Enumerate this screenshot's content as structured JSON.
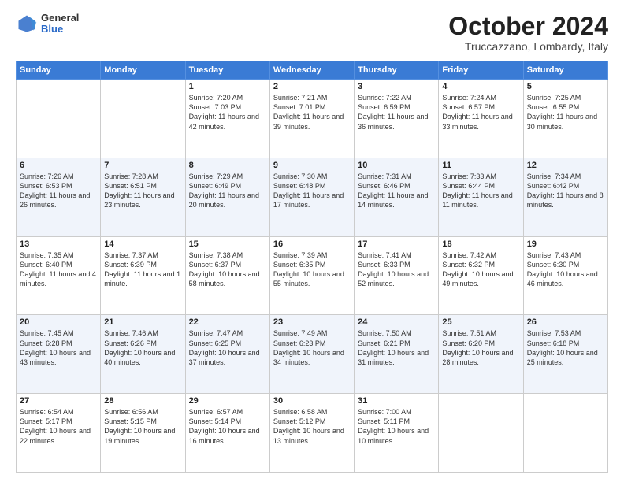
{
  "header": {
    "logo_general": "General",
    "logo_blue": "Blue",
    "title": "October 2024",
    "location": "Truccazzano, Lombardy, Italy"
  },
  "weekdays": [
    "Sunday",
    "Monday",
    "Tuesday",
    "Wednesday",
    "Thursday",
    "Friday",
    "Saturday"
  ],
  "weeks": [
    [
      {
        "day": "",
        "info": ""
      },
      {
        "day": "",
        "info": ""
      },
      {
        "day": "1",
        "info": "Sunrise: 7:20 AM\nSunset: 7:03 PM\nDaylight: 11 hours and 42 minutes."
      },
      {
        "day": "2",
        "info": "Sunrise: 7:21 AM\nSunset: 7:01 PM\nDaylight: 11 hours and 39 minutes."
      },
      {
        "day": "3",
        "info": "Sunrise: 7:22 AM\nSunset: 6:59 PM\nDaylight: 11 hours and 36 minutes."
      },
      {
        "day": "4",
        "info": "Sunrise: 7:24 AM\nSunset: 6:57 PM\nDaylight: 11 hours and 33 minutes."
      },
      {
        "day": "5",
        "info": "Sunrise: 7:25 AM\nSunset: 6:55 PM\nDaylight: 11 hours and 30 minutes."
      }
    ],
    [
      {
        "day": "6",
        "info": "Sunrise: 7:26 AM\nSunset: 6:53 PM\nDaylight: 11 hours and 26 minutes."
      },
      {
        "day": "7",
        "info": "Sunrise: 7:28 AM\nSunset: 6:51 PM\nDaylight: 11 hours and 23 minutes."
      },
      {
        "day": "8",
        "info": "Sunrise: 7:29 AM\nSunset: 6:49 PM\nDaylight: 11 hours and 20 minutes."
      },
      {
        "day": "9",
        "info": "Sunrise: 7:30 AM\nSunset: 6:48 PM\nDaylight: 11 hours and 17 minutes."
      },
      {
        "day": "10",
        "info": "Sunrise: 7:31 AM\nSunset: 6:46 PM\nDaylight: 11 hours and 14 minutes."
      },
      {
        "day": "11",
        "info": "Sunrise: 7:33 AM\nSunset: 6:44 PM\nDaylight: 11 hours and 11 minutes."
      },
      {
        "day": "12",
        "info": "Sunrise: 7:34 AM\nSunset: 6:42 PM\nDaylight: 11 hours and 8 minutes."
      }
    ],
    [
      {
        "day": "13",
        "info": "Sunrise: 7:35 AM\nSunset: 6:40 PM\nDaylight: 11 hours and 4 minutes."
      },
      {
        "day": "14",
        "info": "Sunrise: 7:37 AM\nSunset: 6:39 PM\nDaylight: 11 hours and 1 minute."
      },
      {
        "day": "15",
        "info": "Sunrise: 7:38 AM\nSunset: 6:37 PM\nDaylight: 10 hours and 58 minutes."
      },
      {
        "day": "16",
        "info": "Sunrise: 7:39 AM\nSunset: 6:35 PM\nDaylight: 10 hours and 55 minutes."
      },
      {
        "day": "17",
        "info": "Sunrise: 7:41 AM\nSunset: 6:33 PM\nDaylight: 10 hours and 52 minutes."
      },
      {
        "day": "18",
        "info": "Sunrise: 7:42 AM\nSunset: 6:32 PM\nDaylight: 10 hours and 49 minutes."
      },
      {
        "day": "19",
        "info": "Sunrise: 7:43 AM\nSunset: 6:30 PM\nDaylight: 10 hours and 46 minutes."
      }
    ],
    [
      {
        "day": "20",
        "info": "Sunrise: 7:45 AM\nSunset: 6:28 PM\nDaylight: 10 hours and 43 minutes."
      },
      {
        "day": "21",
        "info": "Sunrise: 7:46 AM\nSunset: 6:26 PM\nDaylight: 10 hours and 40 minutes."
      },
      {
        "day": "22",
        "info": "Sunrise: 7:47 AM\nSunset: 6:25 PM\nDaylight: 10 hours and 37 minutes."
      },
      {
        "day": "23",
        "info": "Sunrise: 7:49 AM\nSunset: 6:23 PM\nDaylight: 10 hours and 34 minutes."
      },
      {
        "day": "24",
        "info": "Sunrise: 7:50 AM\nSunset: 6:21 PM\nDaylight: 10 hours and 31 minutes."
      },
      {
        "day": "25",
        "info": "Sunrise: 7:51 AM\nSunset: 6:20 PM\nDaylight: 10 hours and 28 minutes."
      },
      {
        "day": "26",
        "info": "Sunrise: 7:53 AM\nSunset: 6:18 PM\nDaylight: 10 hours and 25 minutes."
      }
    ],
    [
      {
        "day": "27",
        "info": "Sunrise: 6:54 AM\nSunset: 5:17 PM\nDaylight: 10 hours and 22 minutes."
      },
      {
        "day": "28",
        "info": "Sunrise: 6:56 AM\nSunset: 5:15 PM\nDaylight: 10 hours and 19 minutes."
      },
      {
        "day": "29",
        "info": "Sunrise: 6:57 AM\nSunset: 5:14 PM\nDaylight: 10 hours and 16 minutes."
      },
      {
        "day": "30",
        "info": "Sunrise: 6:58 AM\nSunset: 5:12 PM\nDaylight: 10 hours and 13 minutes."
      },
      {
        "day": "31",
        "info": "Sunrise: 7:00 AM\nSunset: 5:11 PM\nDaylight: 10 hours and 10 minutes."
      },
      {
        "day": "",
        "info": ""
      },
      {
        "day": "",
        "info": ""
      }
    ]
  ]
}
